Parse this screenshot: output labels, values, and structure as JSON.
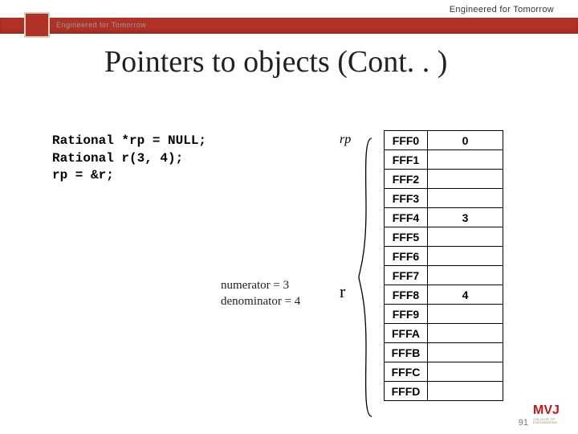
{
  "tagline": "Engineered for Tomorrow",
  "logo_strip_text": "Engineered for Tomorrow",
  "title": "Pointers to objects (Cont. . )",
  "code_lines": [
    "Rational *rp = NULL;",
    "Rational r(3, 4);",
    "rp = &r;"
  ],
  "labels": {
    "rp": "rp",
    "r": "r"
  },
  "annotation": {
    "line1": "numerator = 3",
    "line2": "denominator = 4"
  },
  "memory": [
    {
      "addr": "FFF0",
      "value": "0"
    },
    {
      "addr": "FFF1",
      "value": ""
    },
    {
      "addr": "FFF2",
      "value": ""
    },
    {
      "addr": "FFF3",
      "value": ""
    },
    {
      "addr": "FFF4",
      "value": "3"
    },
    {
      "addr": "FFF5",
      "value": ""
    },
    {
      "addr": "FFF6",
      "value": ""
    },
    {
      "addr": "FFF7",
      "value": ""
    },
    {
      "addr": "FFF8",
      "value": "4"
    },
    {
      "addr": "FFF9",
      "value": ""
    },
    {
      "addr": "FFFA",
      "value": ""
    },
    {
      "addr": "FFFB",
      "value": ""
    },
    {
      "addr": "FFFC",
      "value": ""
    },
    {
      "addr": "FFFD",
      "value": ""
    }
  ],
  "page_number": "91",
  "footer_logo": {
    "main": "MVJ",
    "sub1": "COLLEGE OF",
    "sub2": "ENGINEERING"
  }
}
